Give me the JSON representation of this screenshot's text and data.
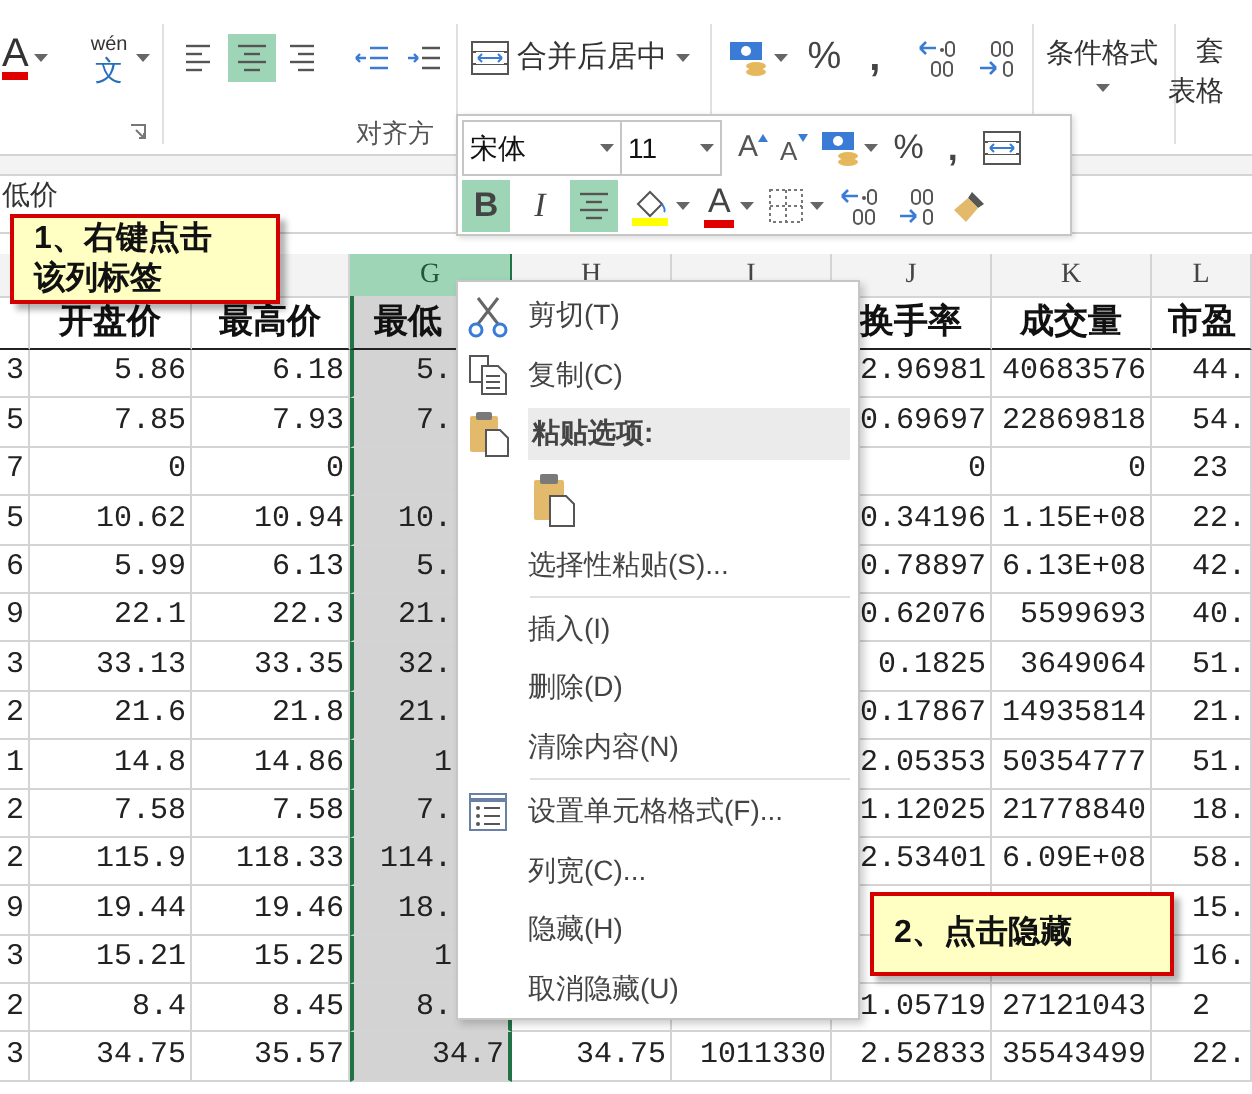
{
  "ribbon": {
    "font_color": "A",
    "phonetic": {
      "top": "wén",
      "bottom": "文"
    },
    "align_buttons": [
      {
        "kind": "left",
        "selected": false
      },
      {
        "kind": "center",
        "selected": true
      },
      {
        "kind": "right",
        "selected": false
      }
    ],
    "merge_button": "合并后居中",
    "percent": "%",
    "comma": ",",
    "conditional_format": "条件格式",
    "table_format": {
      "top": "套",
      "bottom": "表格"
    },
    "group_label": "对齐方"
  },
  "formula_bar": {
    "value": "低价"
  },
  "mini_toolbar": {
    "font": "宋体",
    "size": "11",
    "grow_font": "A",
    "shrink_font": "A",
    "percent": "%",
    "comma": ",",
    "format_buttons": [
      {
        "kind": "bold",
        "label": "B",
        "selected": true
      },
      {
        "kind": "italic",
        "label": "I",
        "selected": false
      },
      {
        "kind": "center",
        "selected": true
      }
    ],
    "font_color": "A"
  },
  "sheet": {
    "column_headers": [
      {
        "letter": "G",
        "selected": true
      },
      {
        "letter": "H",
        "selected": false
      },
      {
        "letter": "I",
        "selected": false
      },
      {
        "letter": "J",
        "selected": false
      },
      {
        "letter": "K",
        "selected": false
      },
      {
        "letter": "L",
        "selected": false
      }
    ],
    "header_row": {
      "column_2": "开盘价",
      "column_3": "最高价",
      "column_4": "最低",
      "column_7": "换手率",
      "column_8": "成交量",
      "column_9": "市盈"
    },
    "rows": [
      {
        "column_1": "3",
        "column_2": "5.86",
        "column_3": "6.18",
        "column_4": "5.",
        "column_7": "2.96981",
        "column_8": "40683576",
        "column_9": "44."
      },
      {
        "column_1": "5",
        "column_2": "7.85",
        "column_3": "7.93",
        "column_4": "7.",
        "column_7": "0.69697",
        "column_8": "22869818",
        "column_9": "54."
      },
      {
        "column_1": "7",
        "column_2": "0",
        "column_3": "0",
        "column_7": "0",
        "column_8": "0",
        "column_9": "23"
      },
      {
        "column_1": "5",
        "column_2": "10.62",
        "column_3": "10.94",
        "column_4": "10.",
        "column_7": "0.34196",
        "column_8": "1.15E+08",
        "column_9": "22."
      },
      {
        "column_1": "6",
        "column_2": "5.99",
        "column_3": "6.13",
        "column_4": "5.",
        "column_7": "0.78897",
        "column_8": "6.13E+08",
        "column_9": "42."
      },
      {
        "column_1": "9",
        "column_2": "22.1",
        "column_3": "22.3",
        "column_4": "21.",
        "column_7": "0.62076",
        "column_8": "5599693",
        "column_9": "40."
      },
      {
        "column_1": "3",
        "column_2": "33.13",
        "column_3": "33.35",
        "column_4": "32.",
        "column_7": "0.1825",
        "column_8": "3649064",
        "column_9": "51."
      },
      {
        "column_1": "2",
        "column_2": "21.6",
        "column_3": "21.8",
        "column_4": "21.",
        "column_7": "0.17867",
        "column_8": "14935814",
        "column_9": "21."
      },
      {
        "column_1": "1",
        "column_2": "14.8",
        "column_3": "14.86",
        "column_4": "1",
        "column_7": "2.05353",
        "column_8": "50354777",
        "column_9": "51."
      },
      {
        "column_1": "2",
        "column_2": "7.58",
        "column_3": "7.58",
        "column_4": "7.",
        "column_7": "1.12025",
        "column_8": "21778840",
        "column_9": "18."
      },
      {
        "column_1": "2",
        "column_2": "115.9",
        "column_3": "118.33",
        "column_4": "114.",
        "column_7": "2.53401",
        "column_8": "6.09E+08",
        "column_9": "58."
      },
      {
        "column_1": "9",
        "column_2": "19.44",
        "column_3": "19.46",
        "column_4": "18.",
        "column_9": "15."
      },
      {
        "column_1": "3",
        "column_2": "15.21",
        "column_3": "15.25",
        "column_4": "1",
        "column_9": "16."
      },
      {
        "column_1": "2",
        "column_2": "8.4",
        "column_3": "8.45",
        "column_4": "8.",
        "column_7": "1.05719",
        "column_8": "27121043",
        "column_9": "2"
      },
      {
        "column_1": "3",
        "column_2": "34.75",
        "column_3": "35.57",
        "column_4": "34.7",
        "column_5": "34.75",
        "column_6": "1011330",
        "column_7": "2.52833",
        "column_8": "35543499",
        "column_9": "22."
      }
    ]
  },
  "context_menu": [
    {
      "kind": "cut",
      "label": "剪切(T)"
    },
    {
      "kind": "copy",
      "label": "复制(C)"
    },
    {
      "kind": "paste_header",
      "label": "粘贴选项:"
    },
    {
      "kind": "paste_option"
    },
    {
      "kind": "item",
      "label": "选择性粘贴(S)..."
    },
    {
      "kind": "separator"
    },
    {
      "kind": "item",
      "label": "插入(I)"
    },
    {
      "kind": "item",
      "label": "删除(D)"
    },
    {
      "kind": "item",
      "label": "清除内容(N)"
    },
    {
      "kind": "separator"
    },
    {
      "kind": "format_cells",
      "label": "设置单元格格式(F)..."
    },
    {
      "kind": "item",
      "label": "列宽(C)..."
    },
    {
      "kind": "item",
      "label": "隐藏(H)"
    },
    {
      "kind": "item",
      "label": "取消隐藏(U)"
    }
  ],
  "callouts": [
    {
      "text": "1、右键点击该列标签"
    },
    {
      "text": "2、点击隐藏"
    }
  ]
}
